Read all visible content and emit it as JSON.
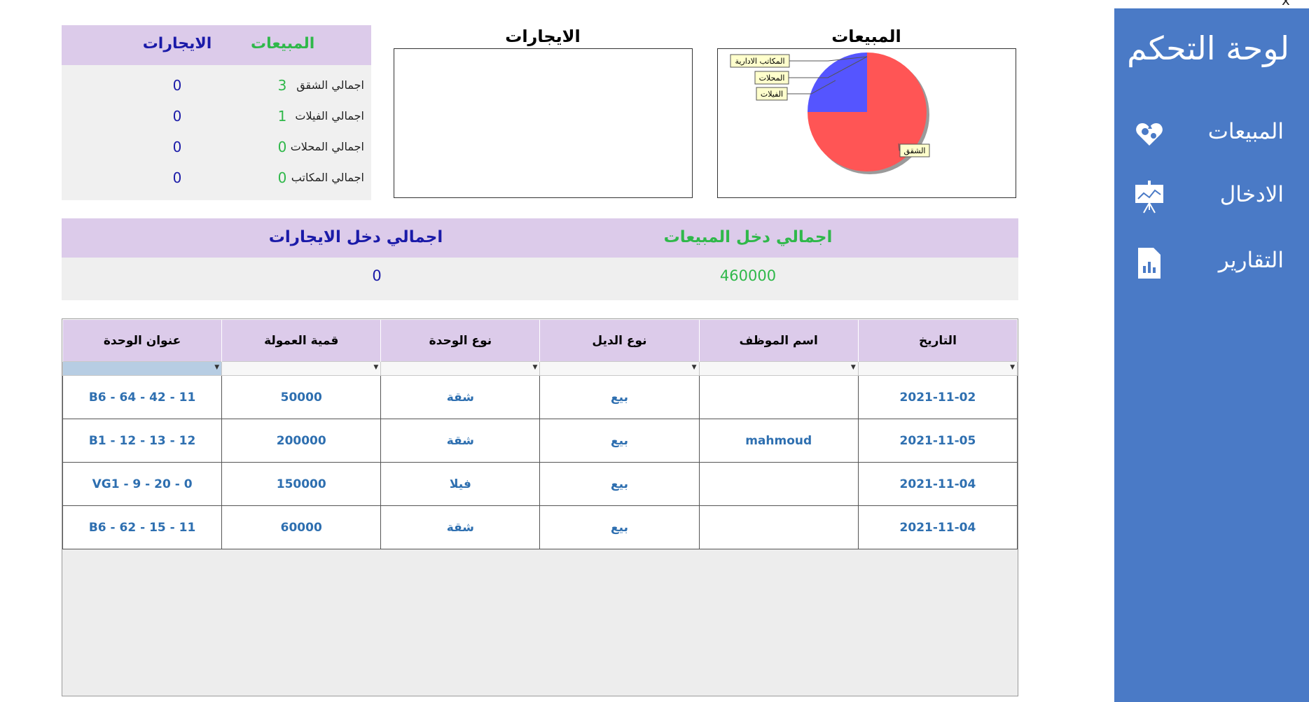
{
  "window": {
    "close_glyph": "x"
  },
  "sidebar": {
    "title": "لوحة التحكم",
    "bg_color": "#4a7ac6",
    "items": [
      {
        "label": "المبيعات",
        "icon": "sales-icon"
      },
      {
        "label": "الادخال",
        "icon": "entry-presentation-icon"
      },
      {
        "label": "التقارير",
        "icon": "reports-document-icon"
      }
    ]
  },
  "summary": {
    "sales_header": "المبيعات",
    "rent_header": "الايجارات",
    "rows": [
      {
        "label": "اجمالي الشقق",
        "sales": "3",
        "rent": "0"
      },
      {
        "label": "اجمالي الفيلات",
        "sales": "1",
        "rent": "0"
      },
      {
        "label": "اجمالي المحلات",
        "sales": "0",
        "rent": "0"
      },
      {
        "label": "اجمالي المكاتب",
        "sales": "0",
        "rent": "0"
      }
    ]
  },
  "charts": {
    "sales_title": "المبيعات",
    "rent_title": "الايجارات"
  },
  "chart_data": [
    {
      "type": "pie",
      "title": "المبيعات",
      "categories": [
        "الشقق",
        "الفيلات",
        "المحلات",
        "المكاتب الادارية"
      ],
      "values": [
        3,
        1,
        0,
        0
      ],
      "colors": [
        "#ff5555",
        "#5555ff",
        "#55aa55",
        "#ffcc00"
      ]
    },
    {
      "type": "pie",
      "title": "الايجارات",
      "categories": [],
      "values": []
    }
  ],
  "income": {
    "sales_label": "اجمالي دخل المبيعات",
    "sales_value": "460000",
    "rent_label": "اجمالي دخل الايجارات",
    "rent_value": "0"
  },
  "grid": {
    "columns": [
      "عنوان الوحدة",
      "قمية العمولة",
      "نوع الوحدة",
      "نوع الديل",
      "اسم الموظف",
      "التاريخ"
    ],
    "rows": [
      [
        "B6 - 64 - 42 - 11",
        "50000",
        "شقة",
        "بيع",
        "",
        "2021-11-02"
      ],
      [
        "B1 - 12 - 13 - 12",
        "200000",
        "شقة",
        "بيع",
        "mahmoud",
        "2021-11-05"
      ],
      [
        "VG1 - 9 - 20 - 0",
        "150000",
        "فيلا",
        "بيع",
        "",
        "2021-11-04"
      ],
      [
        "B6 - 62 - 15 - 11",
        "60000",
        "شقة",
        "بيع",
        "",
        "2021-11-04"
      ]
    ]
  }
}
